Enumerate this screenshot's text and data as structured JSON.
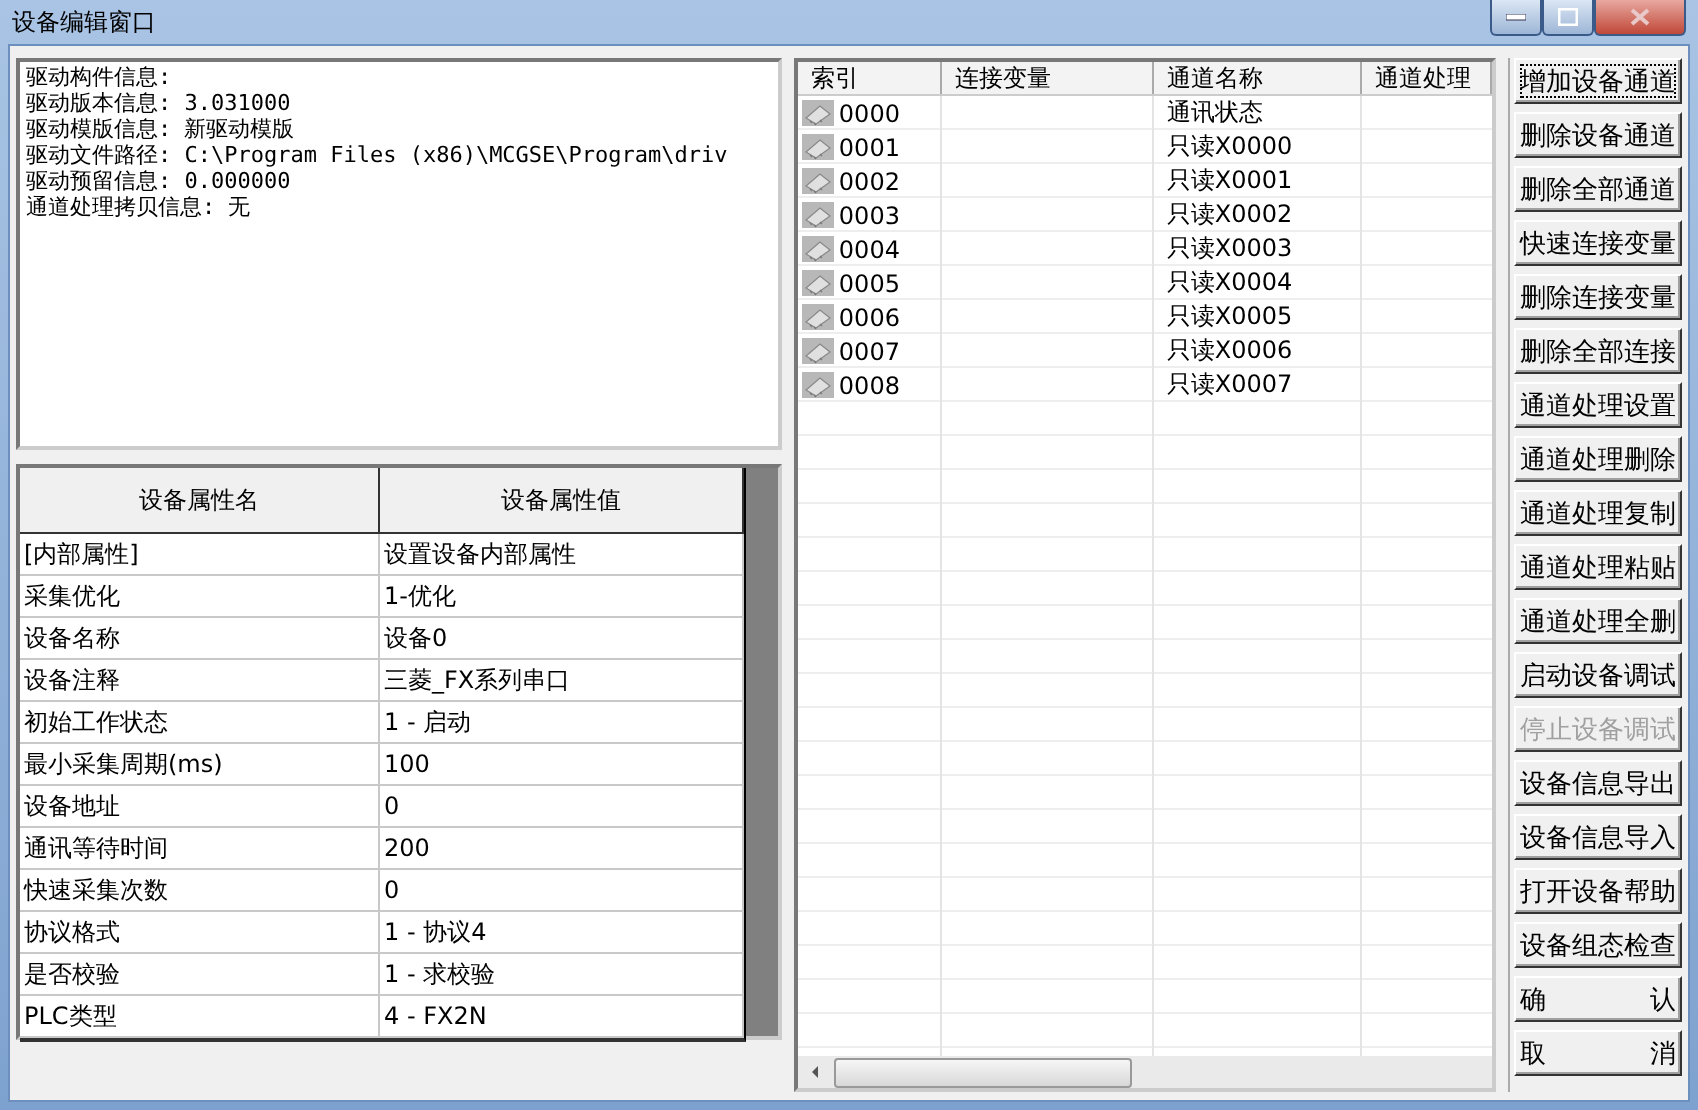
{
  "window": {
    "title": "设备编辑窗口"
  },
  "info_lines": [
    "驱动构件信息:",
    "驱动版本信息: 3.031000",
    "驱动模版信息: 新驱动模版",
    "驱动文件路径: C:\\Program Files (x86)\\MCGSE\\Program\\driv",
    "驱动预留信息: 0.000000",
    "通道处理拷贝信息: 无"
  ],
  "properties": {
    "columns": [
      "设备属性名",
      "设备属性值"
    ],
    "rows": [
      {
        "name": "[内部属性]",
        "value": "设置设备内部属性"
      },
      {
        "name": "采集优化",
        "value": "1-优化"
      },
      {
        "name": "设备名称",
        "value": "设备0"
      },
      {
        "name": "设备注释",
        "value": "三菱_FX系列串口"
      },
      {
        "name": "初始工作状态",
        "value": "1 - 启动"
      },
      {
        "name": "最小采集周期(ms)",
        "value": "100"
      },
      {
        "name": "设备地址",
        "value": "0"
      },
      {
        "name": "通讯等待时间",
        "value": "200"
      },
      {
        "name": "快速采集次数",
        "value": "0"
      },
      {
        "name": "协议格式",
        "value": "1 - 协议4"
      },
      {
        "name": "是否校验",
        "value": "1 - 求校验"
      },
      {
        "name": "PLC类型",
        "value": "4 - FX2N"
      }
    ]
  },
  "channels": {
    "columns": [
      "索引",
      "连接变量",
      "通道名称",
      "通道处理"
    ],
    "rows": [
      {
        "index": "0000",
        "name": "通讯状态"
      },
      {
        "index": "0001",
        "name": "只读X0000"
      },
      {
        "index": "0002",
        "name": "只读X0001"
      },
      {
        "index": "0003",
        "name": "只读X0002"
      },
      {
        "index": "0004",
        "name": "只读X0003"
      },
      {
        "index": "0005",
        "name": "只读X0004"
      },
      {
        "index": "0006",
        "name": "只读X0005"
      },
      {
        "index": "0007",
        "name": "只读X0006"
      },
      {
        "index": "0008",
        "name": "只读X0007"
      }
    ]
  },
  "buttons": [
    {
      "label": "增加设备通道",
      "disabled": false,
      "focused": true
    },
    {
      "label": "删除设备通道",
      "disabled": false,
      "focused": false
    },
    {
      "label": "删除全部通道",
      "disabled": false,
      "focused": false
    },
    {
      "label": "快速连接变量",
      "disabled": false,
      "focused": false
    },
    {
      "label": "删除连接变量",
      "disabled": false,
      "focused": false
    },
    {
      "label": "删除全部连接",
      "disabled": false,
      "focused": false
    },
    {
      "label": "通道处理设置",
      "disabled": false,
      "focused": false
    },
    {
      "label": "通道处理删除",
      "disabled": false,
      "focused": false
    },
    {
      "label": "通道处理复制",
      "disabled": false,
      "focused": false
    },
    {
      "label": "通道处理粘贴",
      "disabled": false,
      "focused": false
    },
    {
      "label": "通道处理全删",
      "disabled": false,
      "focused": false
    },
    {
      "label": "启动设备调试",
      "disabled": false,
      "focused": false
    },
    {
      "label": "停止设备调试",
      "disabled": true,
      "focused": false
    },
    {
      "label": "设备信息导出",
      "disabled": false,
      "focused": false
    },
    {
      "label": "设备信息导入",
      "disabled": false,
      "focused": false
    },
    {
      "label": "打开设备帮助",
      "disabled": false,
      "focused": false
    },
    {
      "label": "设备组态检查",
      "disabled": false,
      "focused": false
    },
    {
      "label": "确 认",
      "disabled": false,
      "focused": false
    },
    {
      "label": "取 消",
      "disabled": false,
      "focused": false
    }
  ]
}
